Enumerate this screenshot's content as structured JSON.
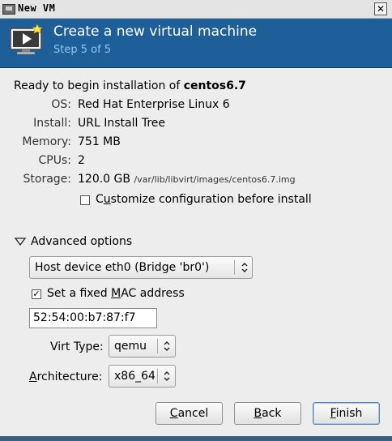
{
  "window": {
    "title": "New VM",
    "close_glyph": "✕"
  },
  "header": {
    "title": "Create a new virtual machine",
    "step": "Step 5 of 5",
    "icon": "vm-monitor-icon"
  },
  "summary": {
    "ready_prefix": "Ready to begin installation of ",
    "vm_name": "centos6.7",
    "rows": [
      {
        "label": "OS:",
        "value": "Red Hat Enterprise Linux 6"
      },
      {
        "label": "Install:",
        "value": "URL Install Tree"
      },
      {
        "label": "Memory:",
        "value": "751 MB"
      },
      {
        "label": "CPUs:",
        "value": "2"
      },
      {
        "label": "Storage:",
        "value": "120.0 GB",
        "path": "/var/lib/libvirt/images/centos6.7.img"
      }
    ],
    "customize": {
      "pre": "C",
      "mnemonic": "u",
      "post": "stomize configuration before install",
      "checked": false
    }
  },
  "advanced": {
    "label": "Advanced options",
    "network": "Host device eth0 (Bridge 'br0')",
    "fixed_mac": {
      "pre": "Set a fixed ",
      "mnemonic": "M",
      "post": "AC address",
      "checked": true,
      "check_glyph": "✓"
    },
    "mac_value": "52:54:00:b7:87:f7",
    "virt_type_label": "Virt Type:",
    "virt_type": "qemu",
    "arch_label": {
      "mnemonic": "A",
      "post": "rchitecture:"
    },
    "architecture": "x86_64"
  },
  "buttons": {
    "cancel": {
      "mnemonic": "C",
      "post": "ancel"
    },
    "back": {
      "mnemonic": "B",
      "post": "ack"
    },
    "finish": {
      "mnemonic": "F",
      "post": "inish"
    }
  }
}
